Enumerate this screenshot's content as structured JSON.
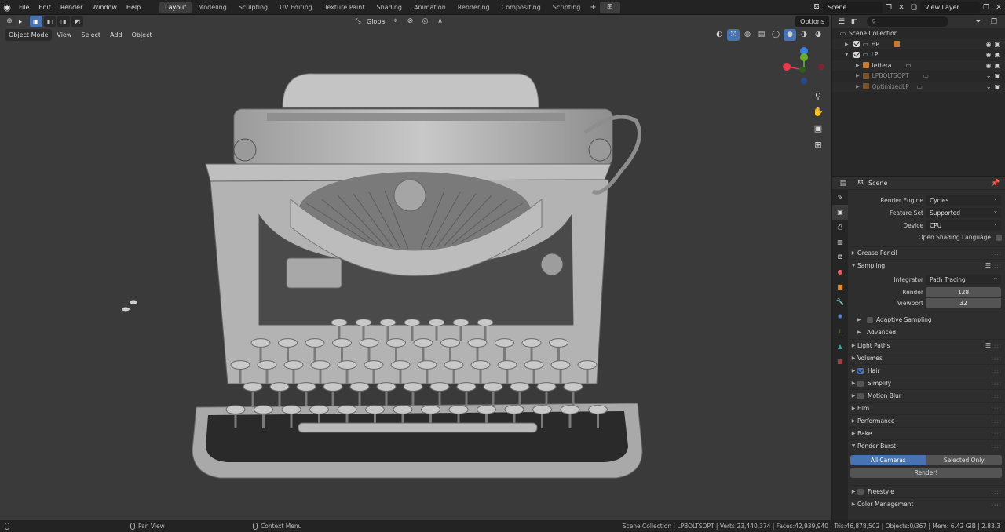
{
  "topbar": {
    "menus": [
      "File",
      "Edit",
      "Render",
      "Window",
      "Help"
    ],
    "workspaces": [
      "Layout",
      "Modeling",
      "Sculpting",
      "UV Editing",
      "Texture Paint",
      "Shading",
      "Animation",
      "Rendering",
      "Compositing",
      "Scripting"
    ],
    "active_workspace": "Layout",
    "scene": "Scene",
    "view_layer": "View Layer"
  },
  "viewport": {
    "mode": "Object Mode",
    "menus": [
      "View",
      "Select",
      "Add",
      "Object"
    ],
    "orientation": "Global",
    "options_label": "Options"
  },
  "outliner": {
    "root": "Scene Collection",
    "items": [
      {
        "label": "HP",
        "dim": false
      },
      {
        "label": "LP",
        "dim": false
      },
      {
        "label": "lettera",
        "dim": false
      },
      {
        "label": "LPBOLTSOPT",
        "dim": true
      },
      {
        "label": "OptimizedLP",
        "dim": true
      }
    ]
  },
  "properties": {
    "context": "Scene",
    "render_engine_label": "Render Engine",
    "render_engine": "Cycles",
    "feature_set_label": "Feature Set",
    "feature_set": "Supported",
    "device_label": "Device",
    "device": "CPU",
    "osl_label": "Open Shading Language",
    "sections": {
      "grease_pencil": "Grease Pencil",
      "sampling": "Sampling",
      "integrator_label": "Integrator",
      "integrator": "Path Tracing",
      "render_label": "Render",
      "render_samples": "128",
      "viewport_label": "Viewport",
      "viewport_samples": "32",
      "adaptive": "Adaptive Sampling",
      "advanced": "Advanced",
      "light_paths": "Light Paths",
      "volumes": "Volumes",
      "hair": "Hair",
      "simplify": "Simplify",
      "motion_blur": "Motion Blur",
      "film": "Film",
      "performance": "Performance",
      "bake": "Bake",
      "render_burst": "Render Burst",
      "all_cameras": "All Cameras",
      "selected_only": "Selected Only",
      "render_btn": "Render!",
      "freestyle": "Freestyle",
      "color_management": "Color Management"
    }
  },
  "statusbar": {
    "pan": "Pan View",
    "context_menu": "Context Menu",
    "stats": "Scene Collection | LPBOLTSOPT | Verts:23,440,374 | Faces:42,939,940 | Tris:46,878,502 | Objects:0/367 | Mem: 6.42 GiB | 2.83.3"
  },
  "colors": {
    "accent": "#4772b3",
    "axis_x": "#e8394d",
    "axis_y": "#6aad2b",
    "axis_z": "#3a7de0"
  }
}
